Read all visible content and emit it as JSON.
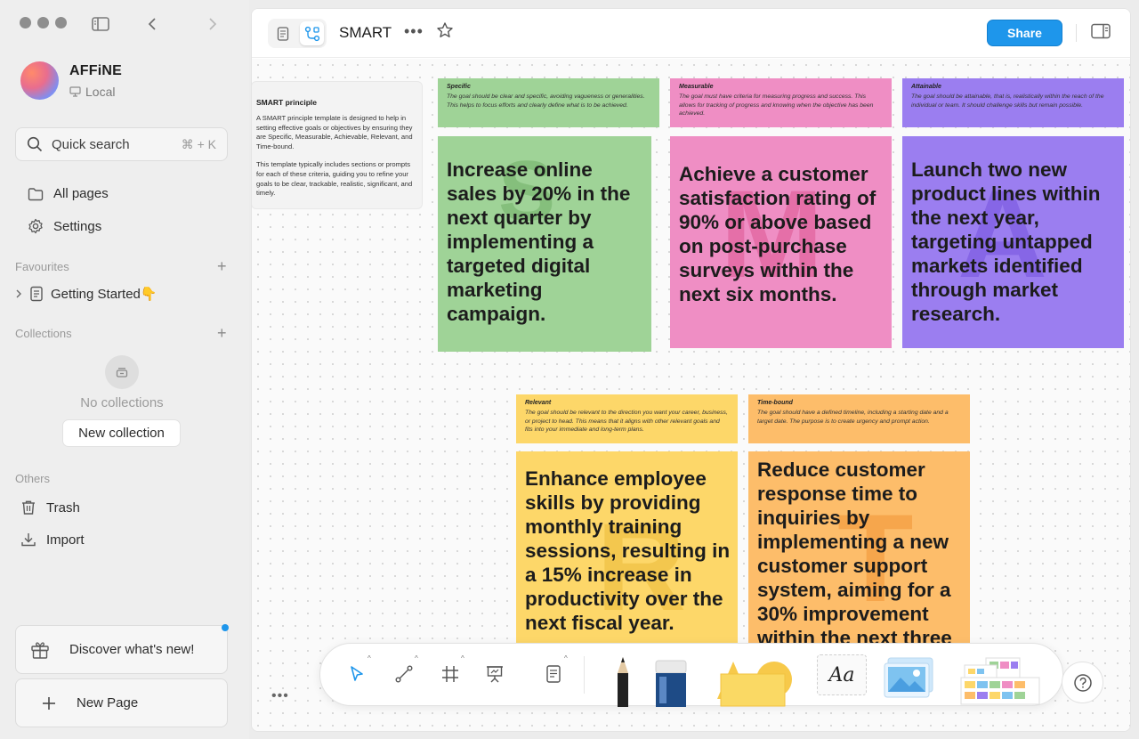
{
  "sidebar": {
    "workspace": {
      "name": "AFFiNE",
      "storage": "Local"
    },
    "quick_search": {
      "label": "Quick search",
      "shortcut": "⌘ + K"
    },
    "nav": {
      "all_pages": "All pages",
      "settings": "Settings"
    },
    "favourites": {
      "label": "Favourites",
      "items": [
        {
          "label": "Getting Started👇"
        }
      ]
    },
    "collections": {
      "label": "Collections",
      "empty_text": "No collections",
      "new_button": "New collection"
    },
    "others": {
      "label": "Others",
      "trash": "Trash",
      "import": "Import"
    },
    "discover": "Discover what's new!",
    "new_page": "New Page"
  },
  "header": {
    "title": "SMART",
    "share": "Share"
  },
  "canvas": {
    "principle": {
      "title": "SMART principle",
      "p1": "A SMART principle template is designed to help in setting effective goals or objectives by ensuring they are Specific, Measurable, Achievable, Relevant, and Time-bound.",
      "p2": "This template typically includes sections or prompts for each of these criteria, guiding you to refine your goals to be clear, trackable, realistic, significant, and timely."
    },
    "criteria": [
      {
        "title": "Specific",
        "text": "The goal should be clear and specific, avoiding vagueness or generalities. This helps to focus efforts and clearly define what is to be achieved.",
        "letter": "S",
        "goal": "Increase online sales by 20% in the next quarter by implementing a targeted digital marketing campaign.",
        "color": "#9fd397"
      },
      {
        "title": "Measurable",
        "text": "The goal must have criteria for measuring progress and success. This allows for tracking of progress and knowing when the objective has been achieved.",
        "letter": "M",
        "goal": "Achieve a customer satisfaction rating of 90% or above based on post-purchase surveys within the next six months.",
        "color": "#ef8ec4"
      },
      {
        "title": "Attainable",
        "text": "The goal should be attainable, that is, realistically within the reach of the individual or team. It should challenge skills but remain possible.",
        "letter": "A",
        "goal": "Launch two new product lines within the next year, targeting untapped markets identified through market research.",
        "color": "#9b7ef0"
      },
      {
        "title": "Relevant",
        "text": "The goal should be relevant to the direction you want your career, business, or project to head. This means that it aligns with other relevant goals and fits into your immediate and long-term plans.",
        "letter": "R",
        "goal": "Enhance employee skills by providing monthly training sessions, resulting in a 15% increase in productivity over the next fiscal year.",
        "color": "#fdd769"
      },
      {
        "title": "Time-bound",
        "text": "The goal should have a defined timeline, including a starting date and a target date. The purpose is to create urgency and prompt action.",
        "letter": "T",
        "goal": "Reduce customer response time to inquiries by implementing a new customer support system, aiming for a 30% improvement within the next three",
        "color": "#fdbd6a"
      }
    ]
  },
  "toolbar": {
    "text_tool": "Aa"
  },
  "colors": {
    "accent": "#1e96eb"
  }
}
